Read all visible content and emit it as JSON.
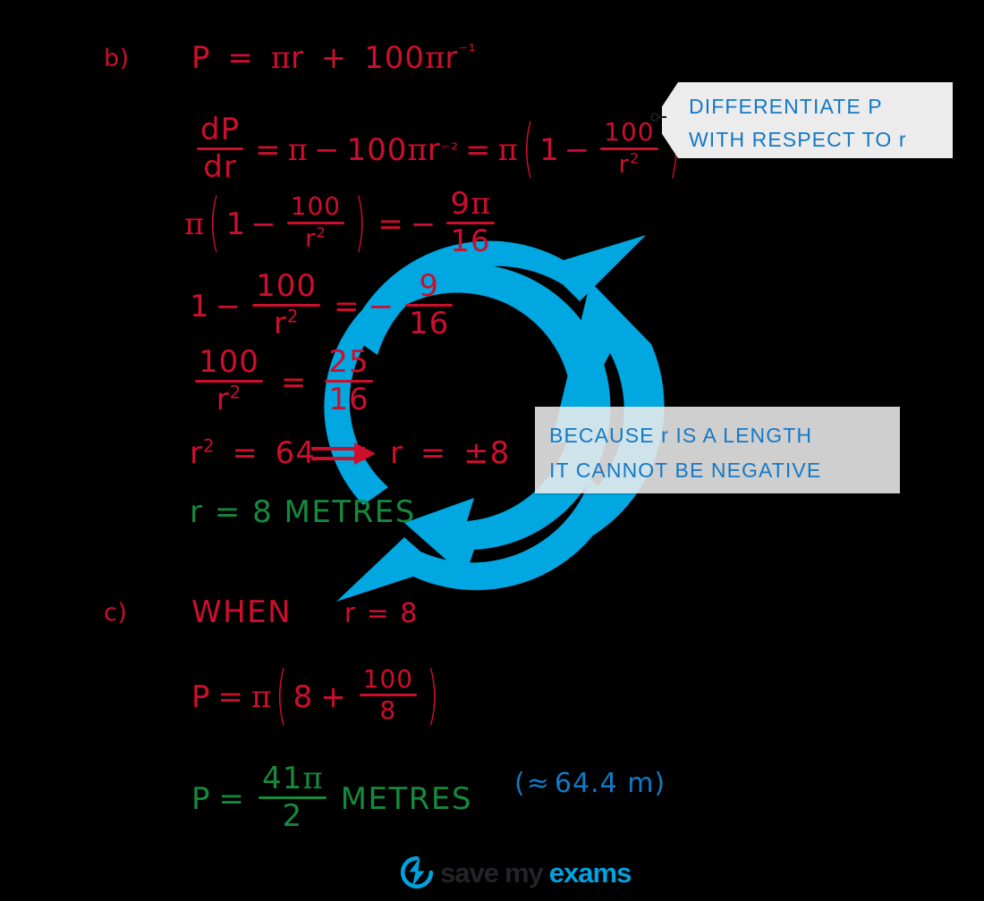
{
  "colors": {
    "red": "#CE0E2D",
    "green": "#158A3C",
    "blue": "#1479C4",
    "watermark_blue": "#00A7E1",
    "callout_bg": "#ECECEC",
    "background": "#000000",
    "logo_dark": "#222428",
    "logo_blue": "#00A3E0"
  },
  "parts": {
    "b": {
      "label": "b)",
      "lines": [
        {
          "id": "b-l1",
          "text": "P = πr + 100πr⁻¹"
        },
        {
          "id": "b-l2",
          "text": "dP/dr = π − 100πr⁻² = π(1 − 100/r²)"
        },
        {
          "id": "b-l3",
          "text": "π(1 − 100/r²) = − 9π/16"
        },
        {
          "id": "b-l4",
          "text": "1 − 100/r² = − 9/16"
        },
        {
          "id": "b-l5",
          "text": "100/r² = 25/16"
        },
        {
          "id": "b-l6",
          "text": "r² = 64  ⇒  r = ±8"
        },
        {
          "id": "b-l7",
          "text": "r = 8 METRES"
        }
      ],
      "tokens": {
        "P": "P",
        "equals": "=",
        "pi": "π",
        "r": "r",
        "plus": "+",
        "minus": "−",
        "one": "1",
        "nine": "9",
        "sixteen": "16",
        "hundred": "100",
        "twentyfive": "25",
        "sixtyfour": "64",
        "eight": "8",
        "plusminus": "±",
        "dP": "dP",
        "dr": "dr",
        "exp_neg1": "⁻¹",
        "exp_neg2": "⁻²",
        "sq": "2",
        "metres": "METRES",
        "r_eq_8_metres": "r = 8 METRES"
      }
    },
    "c": {
      "label": "c)",
      "when_text": "WHEN",
      "when_value": "r = 8",
      "lines": [
        {
          "id": "c-l1",
          "text": "WHEN  r = 8"
        },
        {
          "id": "c-l2",
          "text": "P = π(8 + 100/8)"
        },
        {
          "id": "c-l3",
          "text": "P = 41π/2 METRES   (≈ 64.4 m)"
        }
      ],
      "tokens": {
        "P": "P",
        "equals": "=",
        "pi": "π",
        "eight": "8",
        "plus": "+",
        "hundred": "100",
        "fortyone": "41",
        "two": "2",
        "metres": "METRES",
        "approx_open": "(",
        "approx_sign": "≈",
        "approx_value": "64.4 m",
        "approx_close": ")"
      }
    }
  },
  "callouts": [
    {
      "id": "differentiate-tag",
      "style": "tag",
      "line1": "DIFFERENTIATE  P",
      "line2": "WITH  RESPECT  TO r"
    },
    {
      "id": "length-note",
      "style": "box",
      "line1": "BECAUSE  r  IS  A  LENGTH",
      "line2": "IT  CANNOT  BE  NEGATIVE"
    }
  ],
  "watermark": {
    "name": "refresh-cycle-arrows",
    "color": "#00A7E1"
  },
  "logo": {
    "word1": "save",
    "word2": "my",
    "word3": "exams",
    "icon": "bolt-circle-icon"
  }
}
